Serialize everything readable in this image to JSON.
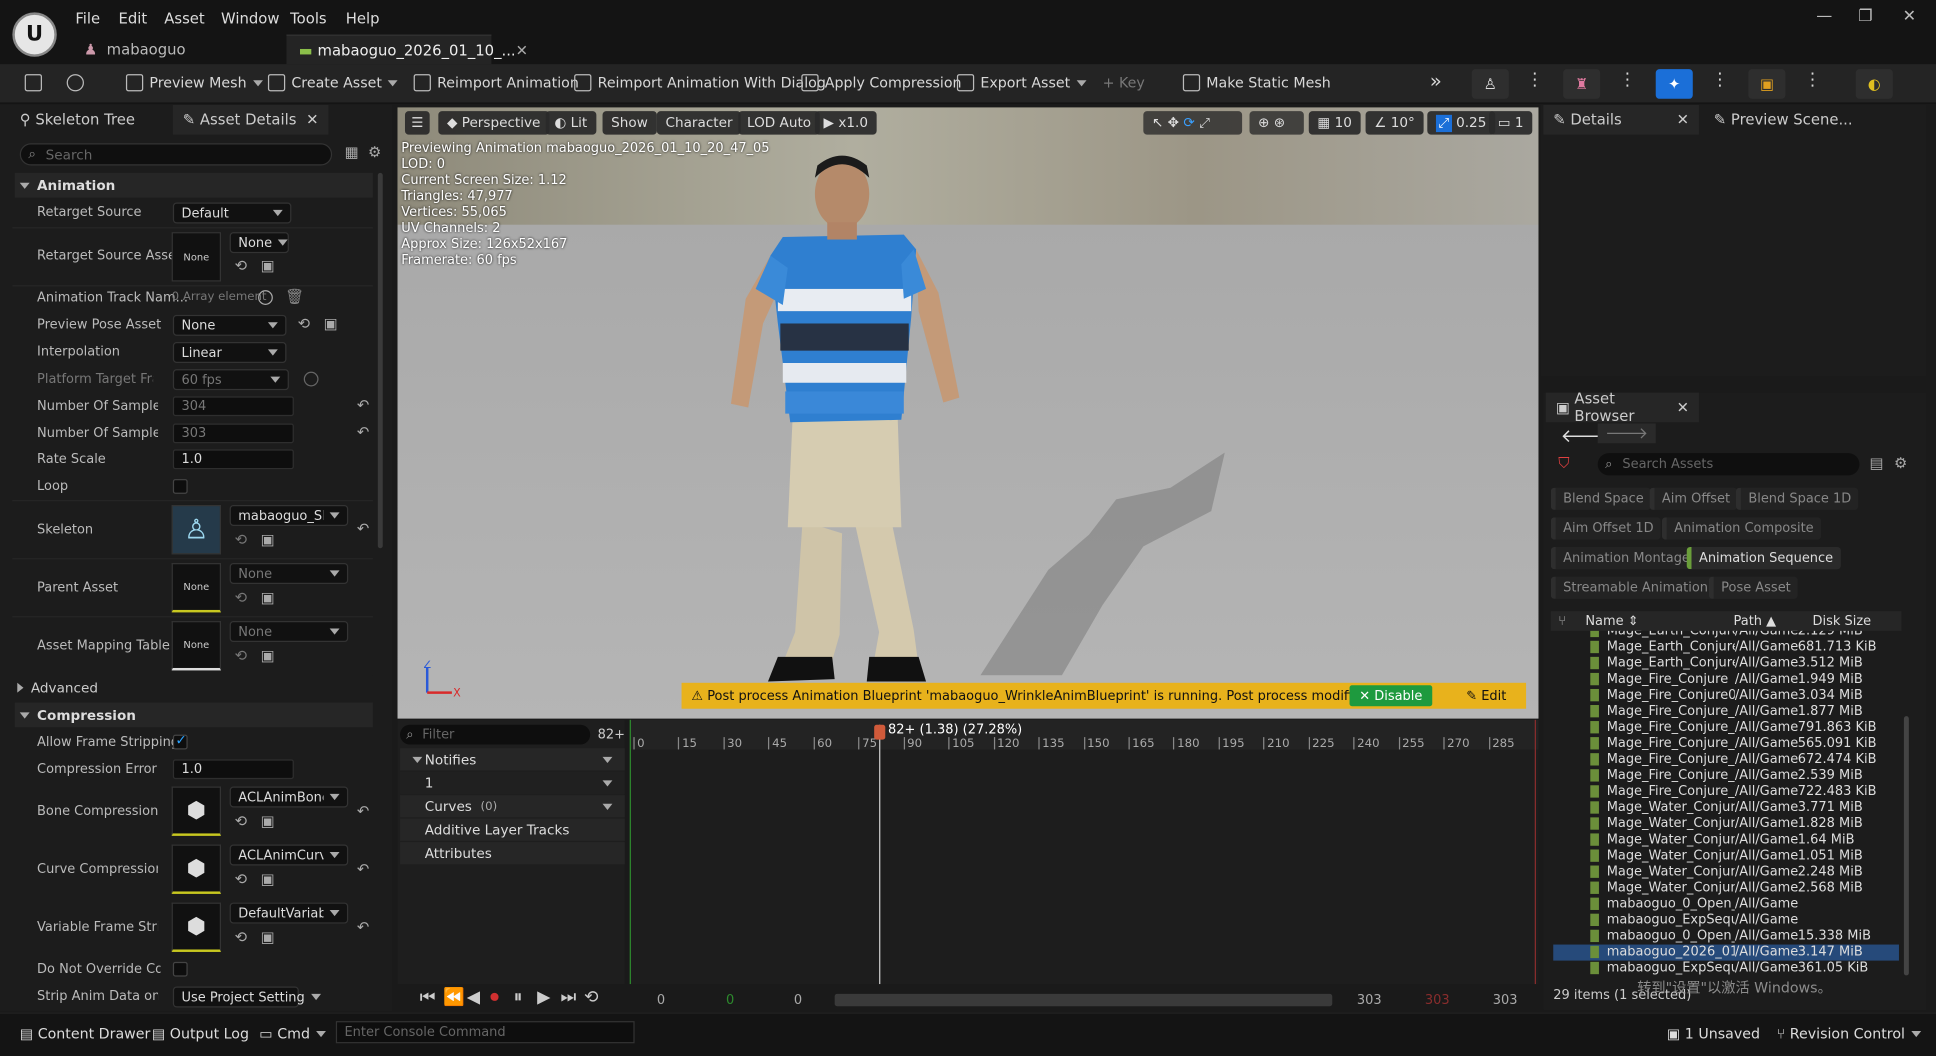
{
  "menu": [
    "File",
    "Edit",
    "Asset",
    "Window",
    "Tools",
    "Help"
  ],
  "doc_tabs": {
    "project": "mabaoguo",
    "asset": "mabaoguo_2026_01_10_..."
  },
  "toolbar": {
    "preview_mesh": "Preview Mesh",
    "create_asset": "Create Asset",
    "reimport": "Reimport Animation",
    "reimport_dialog": "Reimport Animation With Dialog",
    "apply_compression": "Apply Compression",
    "export_asset": "Export Asset",
    "key": "Key",
    "make_static_mesh": "Make Static Mesh"
  },
  "left_panel": {
    "tabs": [
      "Skeleton Tree",
      "Asset Details"
    ],
    "search_placeholder": "Search",
    "animation_section": "Animation",
    "props": {
      "retarget_source": {
        "label": "Retarget Source",
        "value": "Default"
      },
      "retarget_source_asset": {
        "label": "Retarget Source Asset",
        "thumb": "None",
        "value": "None"
      },
      "anim_track_names": {
        "label": "Animation Track Nam...",
        "value": "0 Array element"
      },
      "preview_pose_asset": {
        "label": "Preview Pose Asset",
        "value": "None"
      },
      "interpolation": {
        "label": "Interpolation",
        "value": "Linear"
      },
      "platform_target": {
        "label": "Platform Target Fram...",
        "value": "60 fps"
      },
      "num_sampled_keys": {
        "label": "Number Of Sampled K...",
        "value": "304"
      },
      "num_sampled_frames": {
        "label": "Number Of Sampled F...",
        "value": "303"
      },
      "rate_scale": {
        "label": "Rate Scale",
        "value": "1.0"
      },
      "loop": {
        "label": "Loop"
      },
      "skeleton": {
        "label": "Skeleton",
        "value": "mabaoguo_Skele"
      },
      "parent_asset": {
        "label": "Parent Asset",
        "thumb": "None",
        "value": "None"
      },
      "asset_mapping_table": {
        "label": "Asset Mapping Table",
        "thumb": "None",
        "value": "None"
      }
    },
    "advanced_section": "Advanced",
    "compression_section": "Compression",
    "comp": {
      "allow_frame_stripping": {
        "label": "Allow Frame Stripping"
      },
      "compression_error": {
        "label": "Compression Error Th...",
        "value": "1.0"
      },
      "bone_compression": {
        "label": "Bone Compression Se...",
        "value": "ACLAnimBoneCo"
      },
      "curve_compression": {
        "label": "Curve Compression S...",
        "value": "ACLAnimCurveC"
      },
      "variable_frame": {
        "label": "Variable Frame Strippi...",
        "value": "DefaultVariableF"
      },
      "do_not_override": {
        "label": "Do Not Override Comp..."
      },
      "strip_anim_data": {
        "label": "Strip Anim Data on De...",
        "value": "Use Project Setting"
      }
    }
  },
  "viewport": {
    "buttons": {
      "perspective": "Perspective",
      "lit": "Lit",
      "show": "Show",
      "character": "Character",
      "lod": "LOD Auto",
      "speed": "x1.0",
      "grid": "10",
      "angle": "10°",
      "scale": "0.25",
      "cam": "1"
    },
    "info": [
      "Previewing Animation mabaoguo_2026_01_10_20_47_05",
      "LOD: 0",
      "Current Screen Size: 1.12",
      "Triangles: 47,977",
      "Vertices: 55,065",
      "UV Channels: 2",
      "Approx Size: 126x52x167",
      "Framerate: 60 fps"
    ],
    "warning": "Post process Animation Blueprint 'mabaoguo_WrinkleAnimBlueprint' is running. Post process modifies curves.",
    "disable": "Disable",
    "edit": "Edit"
  },
  "timeline": {
    "filter_placeholder": "Filter",
    "frame_count": "82+",
    "tracks": [
      "Notifies",
      "1",
      "Curves",
      "Additive Layer Tracks",
      "Attributes"
    ],
    "curves_count": "(0)",
    "playhead": "82+ (1.38) (27.28%)",
    "playhead_frame": 82,
    "total_frames": 303,
    "ticks": [
      "0",
      "15",
      "30",
      "45",
      "60",
      "75",
      "90",
      "105",
      "120",
      "135",
      "150",
      "165",
      "180",
      "195",
      "210",
      "225",
      "240",
      "255",
      "270",
      "285"
    ],
    "start": "0",
    "start2": "0",
    "start3": "0",
    "end": "303",
    "end2": "303",
    "end_mid": "303"
  },
  "right_panel": {
    "tabs": [
      "Details",
      "Preview Scene..."
    ],
    "browser_title": "Asset Browser",
    "search_placeholder": "Search Assets",
    "filters": [
      "Blend Space",
      "Aim Offset",
      "Blend Space 1D",
      "Aim Offset 1D",
      "Animation Composite",
      "Animation Montage",
      "Animation Sequence",
      "Streamable Animation",
      "Pose Asset"
    ],
    "columns": {
      "name": "Name",
      "path": "Path",
      "size": "Disk Size"
    },
    "rows": [
      {
        "name": "Mage_Earth_Conjure_",
        "path": "/All/Game/M",
        "size": "2.129 MiB"
      },
      {
        "name": "Mage_Earth_Conjure_",
        "path": "/All/Game/M",
        "size": "681.713 KiB"
      },
      {
        "name": "Mage_Earth_Conjure_",
        "path": "/All/Game/M",
        "size": "3.512 MiB"
      },
      {
        "name": "Mage_Fire_Conjure",
        "path": "/All/Game/M",
        "size": "1.949 MiB"
      },
      {
        "name": "Mage_Fire_Conjure03",
        "path": "/All/Game/M",
        "size": "3.034 MiB"
      },
      {
        "name": "Mage_Fire_Conjure_0:",
        "path": "/All/Game/M",
        "size": "1.877 MiB"
      },
      {
        "name": "Mage_Fire_Conjure_C",
        "path": "/All/Game/M",
        "size": "791.863 KiB"
      },
      {
        "name": "Mage_Fire_Conjure_L",
        "path": "/All/Game/M",
        "size": "565.091 KiB"
      },
      {
        "name": "Mage_Fire_Conjure_L",
        "path": "/All/Game/M",
        "size": "672.474 KiB"
      },
      {
        "name": "Mage_Fire_Conjure_V",
        "path": "/All/Game/M",
        "size": "2.539 MiB"
      },
      {
        "name": "Mage_Fire_Conjure_V",
        "path": "/All/Game/M",
        "size": "722.483 KiB"
      },
      {
        "name": "Mage_Water_Conjure",
        "path": "/All/Game/M",
        "size": "3.771 MiB"
      },
      {
        "name": "Mage_Water_Conjure_",
        "path": "/All/Game/M",
        "size": "1.828 MiB"
      },
      {
        "name": "Mage_Water_Conjure_",
        "path": "/All/Game/M",
        "size": "1.64 MiB"
      },
      {
        "name": "Mage_Water_Conjure_",
        "path": "/All/Game/M",
        "size": "1.051 MiB"
      },
      {
        "name": "Mage_Water_Conjure_",
        "path": "/All/Game/M",
        "size": "2.248 MiB"
      },
      {
        "name": "Mage_Water_Conjure_",
        "path": "/All/Game/M",
        "size": "2.568 MiB"
      },
      {
        "name": "mabaoguo_0_Open_A",
        "path": "/All/Game/R",
        "size": ""
      },
      {
        "name": "mabaoguo_ExpSequer",
        "path": "/All/Game/R",
        "size": ""
      },
      {
        "name": "mabaoguo_0_Open_A",
        "path": "/All/Game/R",
        "size": "15.338 MiB"
      },
      {
        "name": "mabaoguo_2026_01_1",
        "path": "/All/Game/R",
        "size": "3.147 MiB"
      },
      {
        "name": "mabaoguo_ExpSequer",
        "path": "/All/Game/R",
        "size": "361.05 KiB"
      }
    ],
    "count": "29 items (1 selected)",
    "watermark": "转到\"设置\"以激活 Windows。"
  },
  "statusbar": {
    "content_drawer": "Content Drawer",
    "output_log": "Output Log",
    "cmd": "Cmd",
    "console_placeholder": "Enter Console Command",
    "unsaved": "1 Unsaved",
    "revision": "Revision Control"
  }
}
